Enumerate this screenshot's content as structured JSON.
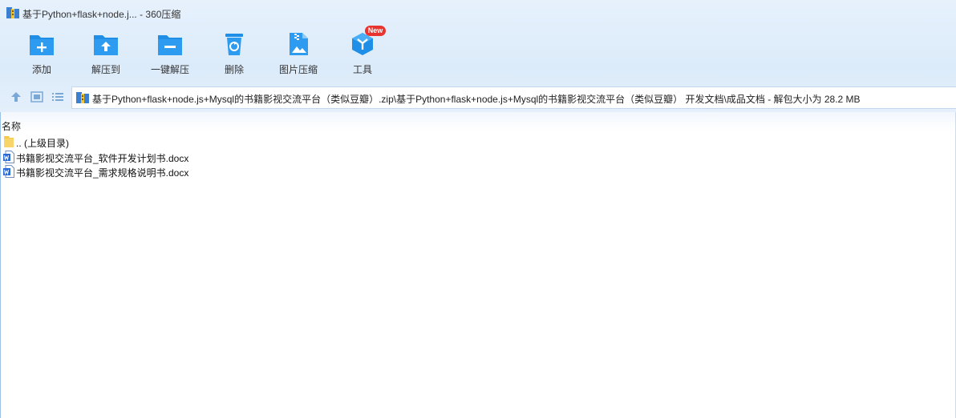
{
  "window": {
    "title": "基于Python+flask+node.j... - 360压缩"
  },
  "toolbar": {
    "items": [
      {
        "label": "添加",
        "icon": "add-icon"
      },
      {
        "label": "解压到",
        "icon": "extract-to-icon"
      },
      {
        "label": "一键解压",
        "icon": "one-click-extract-icon"
      },
      {
        "label": "删除",
        "icon": "delete-icon"
      },
      {
        "label": "图片压缩",
        "icon": "image-compress-icon"
      },
      {
        "label": "工具",
        "icon": "tools-icon"
      }
    ],
    "new_badge": "New"
  },
  "address": {
    "path": "基于Python+flask+node.js+Mysql的书籍影视交流平台（类似豆瓣）.zip\\基于Python+flask+node.js+Mysql的书籍影视交流平台（类似豆瓣） 开发文档\\成品文档 - 解包大小为 28.2 MB"
  },
  "columns": {
    "name": "名称"
  },
  "files": [
    {
      "name": ".. (上级目录)",
      "type": "folder"
    },
    {
      "name": "书籍影视交流平台_软件开发计划书.docx",
      "type": "docx"
    },
    {
      "name": "书籍影视交流平台_需求规格说明书.docx",
      "type": "docx"
    }
  ],
  "colors": {
    "toolbar_icon_blue": "#1e8ee6",
    "badge_red": "#e8332f",
    "folder_yellow": "#f5c94a",
    "word_blue": "#2b6cd4"
  }
}
